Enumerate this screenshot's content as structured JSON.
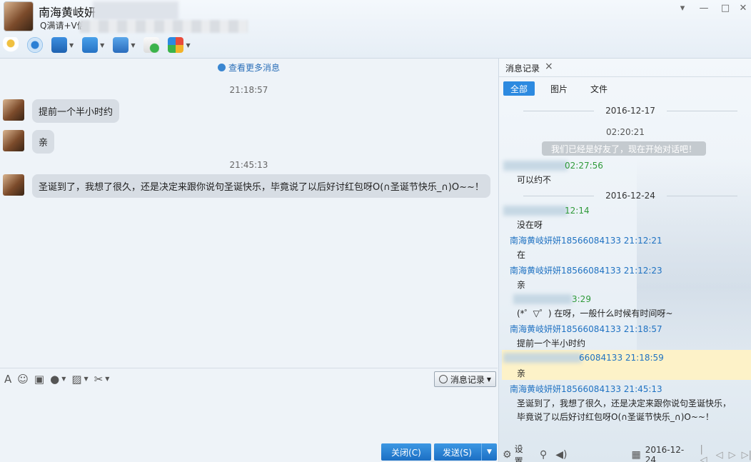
{
  "header": {
    "contact_name": "南海黄岐妍",
    "signature": "Q满请+V信"
  },
  "window_controls": [
    "▾",
    "—",
    "□",
    "✕"
  ],
  "chat": {
    "more_messages": "查看更多消息",
    "timestamps": [
      "21:18:57",
      "21:45:13"
    ],
    "messages": [
      "提前一个半小时约",
      "亲",
      "圣诞到了，我想了很久，还是决定来跟你说句圣诞快乐，毕竟说了以后好讨红包呀O(∩圣诞节快乐_∩)O~~！"
    ]
  },
  "input": {
    "history_label": "消息记录",
    "close_label": "关闭(C)",
    "send_label": "发送(S)"
  },
  "panel": {
    "tab_title": "消息记录",
    "filters": [
      "全部",
      "图片",
      "文件"
    ],
    "dates": [
      "2016-12-17",
      "2016-12-24"
    ],
    "system_time": "02:20:21",
    "system_message": "我们已经是好友了，现在开始对话吧！",
    "history": [
      {
        "head": "02:27:56",
        "body": "可以约不",
        "color": "green"
      },
      {
        "head": "12:14",
        "body": "没在呀",
        "color": "green"
      },
      {
        "head": "南海黄岐妍妍18566084133 21:12:21",
        "body": "在",
        "color": "blue"
      },
      {
        "head": "南海黄岐妍妍18566084133 21:12:23",
        "body": "亲",
        "color": "blue"
      },
      {
        "head": "3:29",
        "body": "(*゜▽゜) 在呀，一般什么时候有时间呀~",
        "color": "green"
      },
      {
        "head": "南海黄岐妍妍18566084133 21:18:57",
        "body": "提前一个半小时约",
        "color": "blue"
      },
      {
        "head": "66084133 21:18:59",
        "body": "亲",
        "color": "blue"
      },
      {
        "head": "南海黄岐妍妍18566084133 21:45:13",
        "body": "圣诞到了，我想了很久，还是决定来跟你说句圣诞快乐，毕竟说了以后好讨红包呀O(∩圣诞节快乐_∩)O~~！",
        "color": "blue"
      }
    ],
    "footer": {
      "settings_label": "设置",
      "date": "2016-12-24"
    }
  },
  "colors": {
    "accent": "#2d8ae0",
    "link": "#1f72c2",
    "green": "#2f9a3a",
    "highlight": "#fdf2c8"
  }
}
